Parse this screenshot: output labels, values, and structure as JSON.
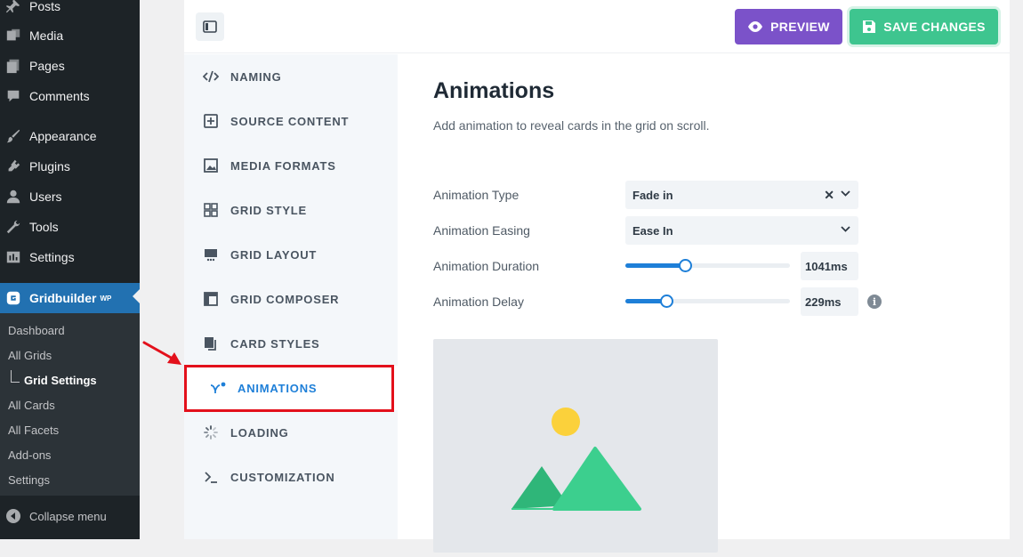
{
  "wp_menu": {
    "items": [
      {
        "label": "Posts",
        "icon": "pin-icon"
      },
      {
        "label": "Media",
        "icon": "media-icon"
      },
      {
        "label": "Pages",
        "icon": "pages-icon"
      },
      {
        "label": "Comments",
        "icon": "comment-icon"
      },
      {
        "label": "Appearance",
        "icon": "brush-icon"
      },
      {
        "label": "Plugins",
        "icon": "plugin-icon"
      },
      {
        "label": "Users",
        "icon": "user-icon"
      },
      {
        "label": "Tools",
        "icon": "wrench-icon"
      },
      {
        "label": "Settings",
        "icon": "settings-icon"
      }
    ],
    "active": {
      "label": "Gridbuilder",
      "badge": "WP"
    },
    "submenu": [
      "Dashboard",
      "All Grids",
      "Grid Settings",
      "All Cards",
      "All Facets",
      "Add-ons",
      "Settings"
    ],
    "current_submenu": "Grid Settings",
    "collapse_label": "Collapse menu"
  },
  "toolbar": {
    "preview_label": "PREVIEW",
    "save_label": "SAVE CHANGES",
    "preview_color": "#7b52c9",
    "save_color": "#3ec58f"
  },
  "nav": {
    "items": [
      {
        "label": "NAMING",
        "icon": "code-icon"
      },
      {
        "label": "SOURCE CONTENT",
        "icon": "add-file-icon"
      },
      {
        "label": "MEDIA FORMATS",
        "icon": "image-icon"
      },
      {
        "label": "GRID STYLE",
        "icon": "grid-icon"
      },
      {
        "label": "GRID LAYOUT",
        "icon": "layout-icon"
      },
      {
        "label": "GRID COMPOSER",
        "icon": "composer-icon"
      },
      {
        "label": "CARD STYLES",
        "icon": "cards-icon"
      },
      {
        "label": "ANIMATIONS",
        "icon": "animation-icon"
      },
      {
        "label": "LOADING",
        "icon": "spinner-icon"
      },
      {
        "label": "CUSTOMIZATION",
        "icon": "terminal-icon"
      }
    ],
    "active_index": 7,
    "accent": "#1e7fd8"
  },
  "main": {
    "title": "Animations",
    "description": "Add animation to reveal cards in the grid on scroll.",
    "animation_type": {
      "label": "Animation Type",
      "value": "Fade in"
    },
    "animation_easing": {
      "label": "Animation Easing",
      "value": "Ease In"
    },
    "animation_duration": {
      "label": "Animation Duration",
      "value": "1041ms",
      "fraction": 0.36
    },
    "animation_delay": {
      "label": "Animation Delay",
      "value": "229ms",
      "fraction": 0.25
    }
  },
  "annotation": {
    "highlight_color": "#e3101b"
  }
}
